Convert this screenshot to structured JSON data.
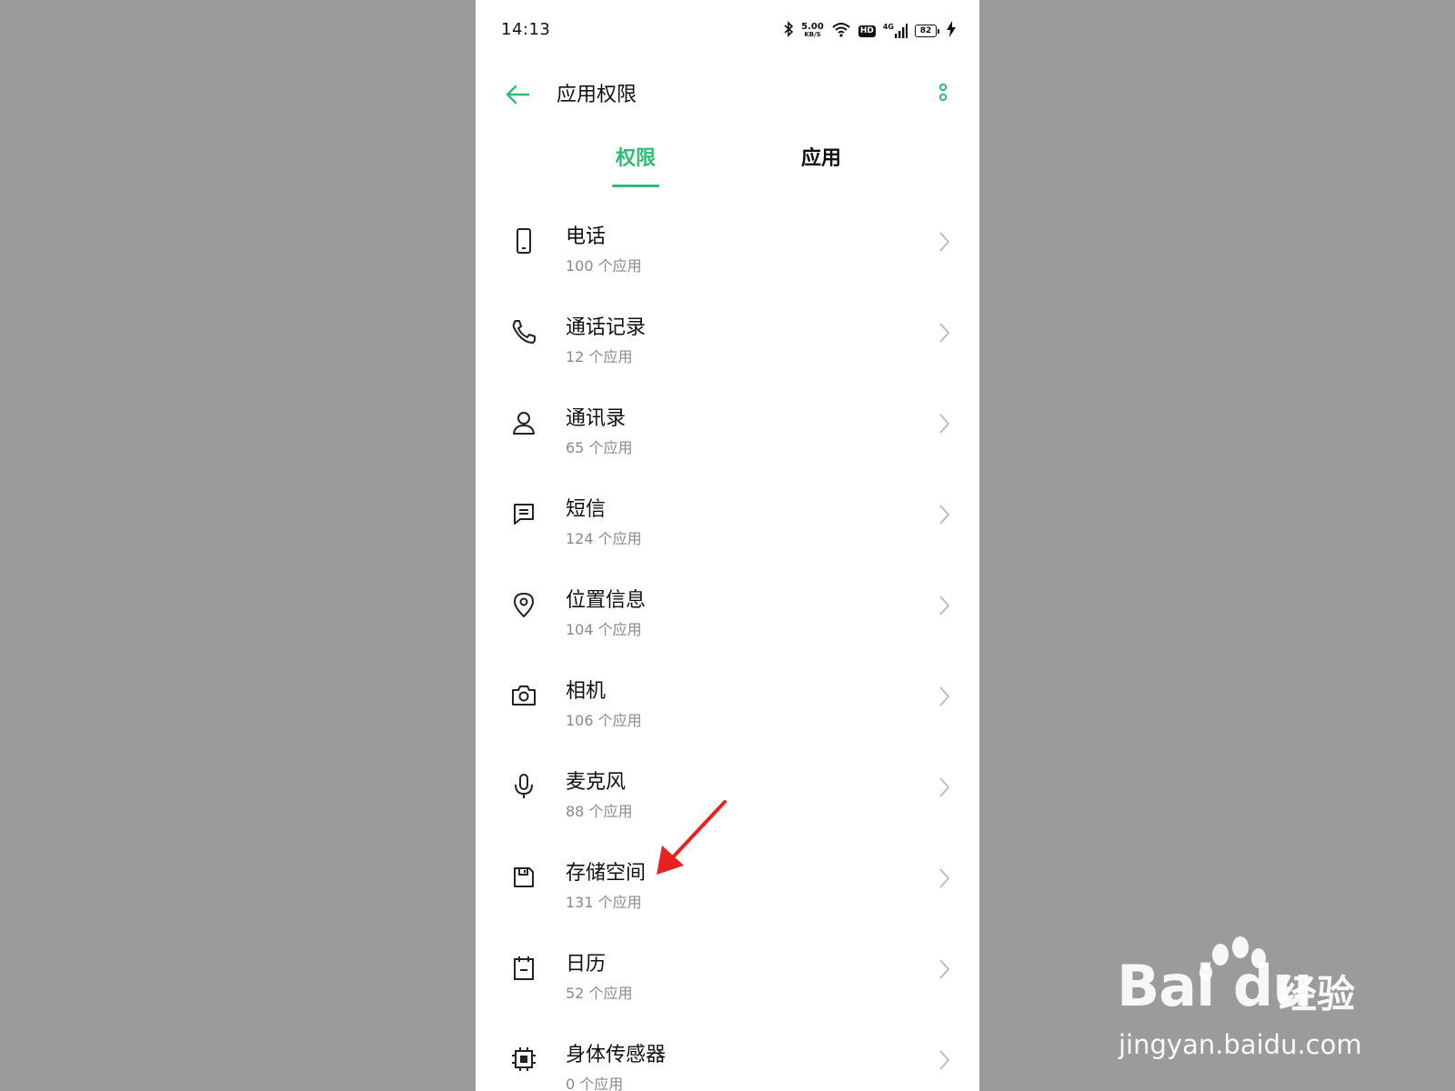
{
  "status_bar": {
    "time": "14:13",
    "net_speed_value": "5.00",
    "net_speed_unit": "KB/S",
    "hd_badge": "HD",
    "network_type": "4G",
    "battery": "82"
  },
  "app_bar": {
    "title": "应用权限"
  },
  "tabs": [
    {
      "label": "权限",
      "active": true
    },
    {
      "label": "应用",
      "active": false
    }
  ],
  "permissions": [
    {
      "title": "电话",
      "subtitle": "100 个应用",
      "icon": "phone-device-icon"
    },
    {
      "title": "通话记录",
      "subtitle": "12 个应用",
      "icon": "call-log-icon"
    },
    {
      "title": "通讯录",
      "subtitle": "65 个应用",
      "icon": "contacts-icon"
    },
    {
      "title": "短信",
      "subtitle": "124 个应用",
      "icon": "sms-icon"
    },
    {
      "title": "位置信息",
      "subtitle": "104 个应用",
      "icon": "location-icon"
    },
    {
      "title": "相机",
      "subtitle": "106 个应用",
      "icon": "camera-icon"
    },
    {
      "title": "麦克风",
      "subtitle": "88 个应用",
      "icon": "microphone-icon"
    },
    {
      "title": "存储空间",
      "subtitle": "131 个应用",
      "icon": "storage-icon"
    },
    {
      "title": "日历",
      "subtitle": "52 个应用",
      "icon": "calendar-icon"
    },
    {
      "title": "身体传感器",
      "subtitle": "0 个应用",
      "icon": "body-sensor-icon"
    }
  ],
  "colors": {
    "accent": "#2fbd76",
    "annotation_arrow": "#e8231f",
    "backdrop": "#9b9b9b"
  },
  "watermark": {
    "brand": "Bai du",
    "cn": "经验",
    "url": "jingyan.baidu.com"
  }
}
